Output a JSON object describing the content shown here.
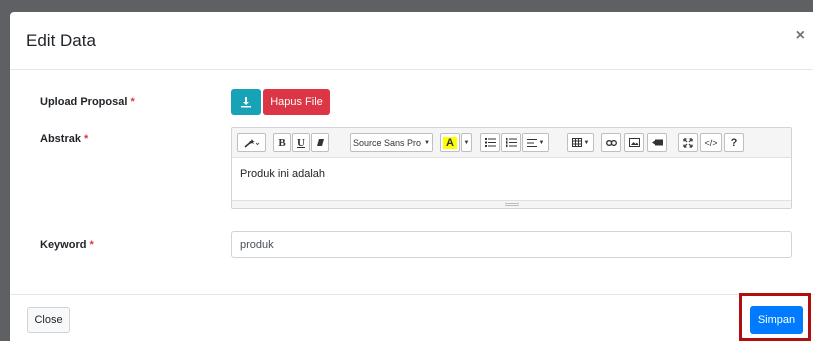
{
  "modal": {
    "title": "Edit Data",
    "close_symbol": "×"
  },
  "form": {
    "upload": {
      "label": "Upload Proposal",
      "required": "*",
      "download_icon": "download-icon",
      "delete_label": "Hapus File"
    },
    "abstrak": {
      "label": "Abstrak",
      "required": "*",
      "toolbar": {
        "magic_icon": "magic-wand-icon",
        "bold": "B",
        "underline": "U",
        "eraser_icon": "eraser-icon",
        "font_name": "Source Sans Pro",
        "color_letter": "A",
        "ul_icon": "unordered-list-icon",
        "ol_icon": "ordered-list-icon",
        "align_icon": "align-icon",
        "table_icon": "table-icon",
        "link_icon": "link-icon",
        "image_icon": "image-icon",
        "video_icon": "video-icon",
        "fullscreen_icon": "fullscreen-icon",
        "code_label": "</>",
        "help_label": "?"
      },
      "content": "Produk ini adalah"
    },
    "keyword": {
      "label": "Keyword",
      "required": "*",
      "value": "produk"
    }
  },
  "footer": {
    "close_label": "Close",
    "save_label": "Simpan"
  },
  "colors": {
    "primary": "#007bff",
    "danger": "#dc3545",
    "info": "#17a2b8",
    "highlight": "#b00d0d"
  }
}
